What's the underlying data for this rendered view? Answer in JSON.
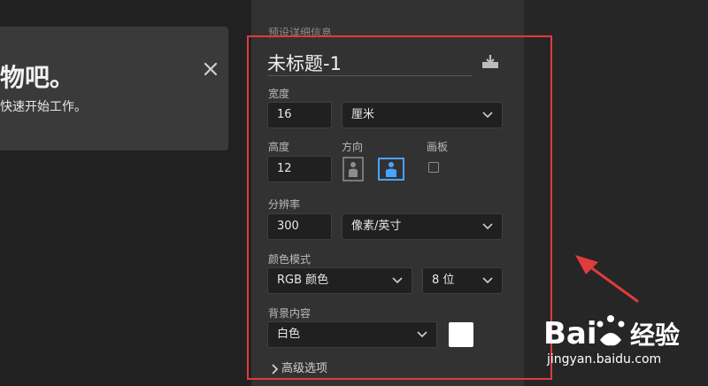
{
  "welcome": {
    "heading": "物吧。",
    "subtitle": "快速开始工作。"
  },
  "preset_details": {
    "header": "预设详细信息",
    "document_title": "未标题-1",
    "width": {
      "label": "宽度",
      "value": "16",
      "unit": "厘米"
    },
    "height": {
      "label": "高度",
      "value": "12"
    },
    "orientation": {
      "label": "方向",
      "selected": "landscape"
    },
    "artboard": {
      "label": "画板",
      "checked": false
    },
    "resolution": {
      "label": "分辨率",
      "value": "300",
      "unit": "像素/英寸"
    },
    "color_mode": {
      "label": "颜色模式",
      "mode": "RGB 颜色",
      "bit_depth": "8 位"
    },
    "background": {
      "label": "背景内容",
      "value": "白色",
      "swatch_color": "#ffffff"
    },
    "advanced_label": "高级选项"
  },
  "annotation": {
    "highlight_color": "#e13b3b"
  },
  "watermark": {
    "logo_text": "Bai 经验",
    "url": "jingyan.baidu.com"
  },
  "colors": {
    "accent": "#4aa3ff",
    "panel": "#323232",
    "field": "#202020"
  }
}
